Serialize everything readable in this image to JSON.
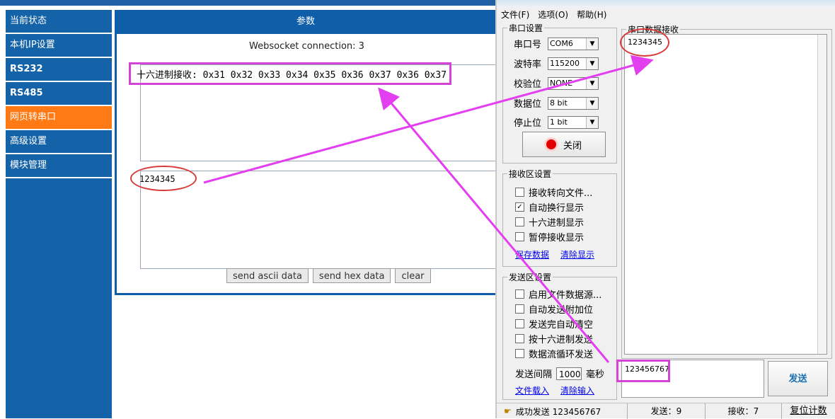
{
  "sidebar": {
    "items": [
      {
        "label": "当前状态"
      },
      {
        "label": "本机IP设置"
      },
      {
        "label": "RS232"
      },
      {
        "label": "RS485"
      },
      {
        "label": "网页转串口"
      },
      {
        "label": "高级设置"
      },
      {
        "label": "模块管理"
      }
    ],
    "active_index": 4,
    "active_color": "#ff7a14",
    "bg_color": "#1462a7"
  },
  "panel": {
    "title": "参数",
    "ws_status": "Websocket connection: 3",
    "hex_receive_text": "十六进制接收: 0x31 0x32 0x33 0x34 0x35 0x36 0x37 0x36 0x37",
    "received_text": "1234345",
    "buttons": {
      "send_ascii": "send ascii data",
      "send_hex": "send hex data",
      "clear": "clear"
    }
  },
  "serial_tool": {
    "menu": [
      "文件(F)",
      "选项(O)",
      "帮助(H)"
    ],
    "port_settings": {
      "title": "串口设置",
      "port": {
        "label": "串口号",
        "value": "COM6"
      },
      "baud": {
        "label": "波特率",
        "value": "115200"
      },
      "parity": {
        "label": "校验位",
        "value": "NONE"
      },
      "data_bits": {
        "label": "数据位",
        "value": "8 bit"
      },
      "stop_bits": {
        "label": "停止位",
        "value": "1 bit"
      },
      "close_button": "关闭"
    },
    "receive_settings": {
      "title": "接收区设置",
      "options": [
        {
          "label": "接收转向文件...",
          "checked": false
        },
        {
          "label": "自动换行显示",
          "checked": true
        },
        {
          "label": "十六进制显示",
          "checked": false
        },
        {
          "label": "暂停接收显示",
          "checked": false
        }
      ],
      "save_link": "保存数据",
      "clear_link": "清除显示"
    },
    "send_settings": {
      "title": "发送区设置",
      "options": [
        {
          "label": "启用文件数据源...",
          "checked": false
        },
        {
          "label": "自动发送附加位",
          "checked": false
        },
        {
          "label": "发送完自动清空",
          "checked": false
        },
        {
          "label": "按十六进制发送",
          "checked": false
        },
        {
          "label": "数据流循环发送",
          "checked": false
        }
      ],
      "interval_label": "发送间隔",
      "interval_value": "1000",
      "interval_unit": "毫秒",
      "load_link": "文件载入",
      "clear_link": "清除输入"
    },
    "rx_area": {
      "title": "串口数据接收",
      "text": "1234345"
    },
    "tx_area": {
      "text": "123456767"
    },
    "send_button": "发送",
    "status": {
      "message": "成功发送 123456767",
      "sent": "发送：9",
      "received": "接收：7",
      "reset": "复位计数"
    }
  }
}
